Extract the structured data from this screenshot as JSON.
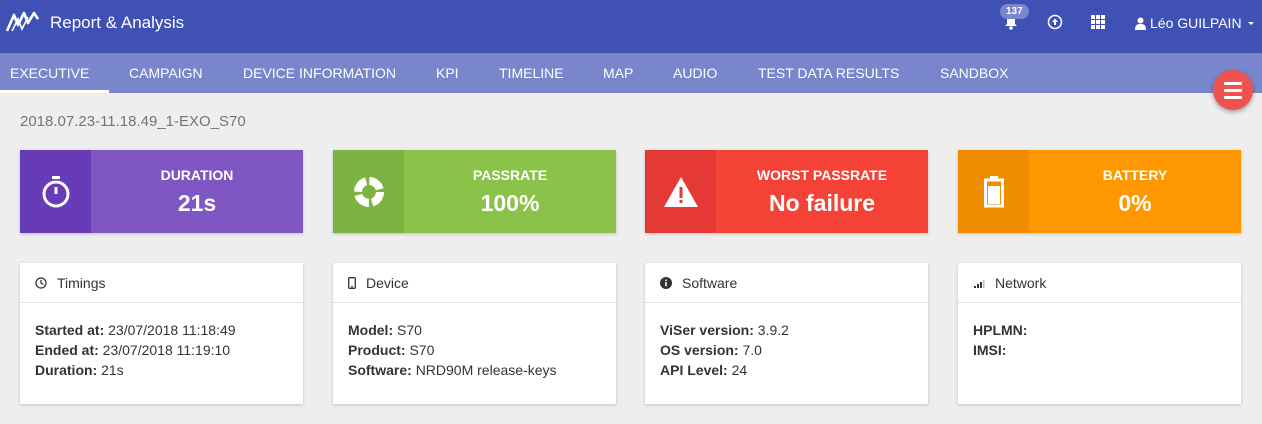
{
  "header": {
    "title": "Report & Analysis",
    "notification_count": "137",
    "user_name": "Léo GUILPAIN",
    "colors": {
      "bar": "#3f51b5",
      "nav": "#7986cb"
    }
  },
  "tabs": [
    {
      "label": "EXECUTIVE",
      "active": true
    },
    {
      "label": "CAMPAIGN"
    },
    {
      "label": "DEVICE INFORMATION"
    },
    {
      "label": "KPI"
    },
    {
      "label": "TIMELINE"
    },
    {
      "label": "MAP"
    },
    {
      "label": "AUDIO"
    },
    {
      "label": "TEST DATA RESULTS"
    },
    {
      "label": "SANDBOX"
    }
  ],
  "report_name": "2018.07.23-11.18.49_1-EXO_S70",
  "kpis": [
    {
      "label": "DURATION",
      "value": "21s",
      "icon": "stopwatch-icon",
      "color": "#7e57c2",
      "icon_bg": "#673ab7"
    },
    {
      "label": "PASSRATE",
      "value": "100%",
      "icon": "donut-chart-icon",
      "color": "#8bc34a",
      "icon_bg": "#7cb342"
    },
    {
      "label": "WORST PASSRATE",
      "value": "No failure",
      "icon": "warning-icon",
      "color": "#f44336",
      "icon_bg": "#e53935"
    },
    {
      "label": "BATTERY",
      "value": "0%",
      "icon": "battery-icon",
      "color": "#ff9800",
      "icon_bg": "#f08c00"
    }
  ],
  "cards": [
    {
      "title": "Timings",
      "icon": "clock-icon",
      "rows": [
        {
          "label": "Started at:",
          "value": "23/07/2018 11:18:49"
        },
        {
          "label": "Ended at:",
          "value": "23/07/2018 11:19:10"
        },
        {
          "label": "Duration:",
          "value": "21s"
        }
      ]
    },
    {
      "title": "Device",
      "icon": "phone-icon",
      "rows": [
        {
          "label": "Model:",
          "value": "S70"
        },
        {
          "label": "Product:",
          "value": "S70"
        },
        {
          "label": "Software:",
          "value": "NRD90M release-keys"
        }
      ]
    },
    {
      "title": "Software",
      "icon": "info-icon",
      "rows": [
        {
          "label": "ViSer version:",
          "value": "3.9.2"
        },
        {
          "label": "OS version:",
          "value": "7.0"
        },
        {
          "label": "API Level:",
          "value": "24"
        }
      ]
    },
    {
      "title": "Network",
      "icon": "signal-icon",
      "rows": [
        {
          "label": "HPLMN:",
          "value": ""
        },
        {
          "label": "IMSI:",
          "value": ""
        }
      ]
    }
  ]
}
